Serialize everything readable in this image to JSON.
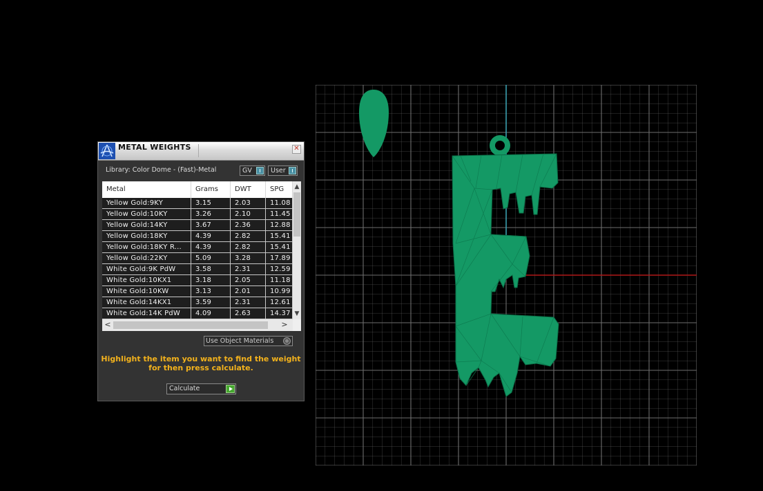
{
  "panel": {
    "title": "METAL WEIGHTS",
    "close_glyph": "✕",
    "library": "Library: Color Dome - (Fast)-Metal",
    "gv_label": "GV",
    "user_label": "User",
    "columns": [
      "Metal",
      "Grams",
      "DWT",
      "SPG"
    ],
    "rows": [
      {
        "metal": "Yellow Gold:9KY",
        "grams": "3.15",
        "dwt": "2.03",
        "spg": "11.08"
      },
      {
        "metal": "Yellow Gold:10KY",
        "grams": "3.26",
        "dwt": "2.10",
        "spg": "11.45"
      },
      {
        "metal": "Yellow Gold:14KY",
        "grams": "3.67",
        "dwt": "2.36",
        "spg": "12.88"
      },
      {
        "metal": "Yellow Gold:18KY",
        "grams": "4.39",
        "dwt": "2.82",
        "spg": "15.41"
      },
      {
        "metal": "Yellow Gold:18KY R...",
        "grams": "4.39",
        "dwt": "2.82",
        "spg": "15.41"
      },
      {
        "metal": "Yellow Gold:22KY",
        "grams": "5.09",
        "dwt": "3.28",
        "spg": "17.89"
      },
      {
        "metal": "White Gold:9K PdW",
        "grams": "3.58",
        "dwt": "2.31",
        "spg": "12.59"
      },
      {
        "metal": "White Gold:10KX1",
        "grams": "3.18",
        "dwt": "2.05",
        "spg": "11.18"
      },
      {
        "metal": "White Gold:10KW",
        "grams": "3.13",
        "dwt": "2.01",
        "spg": "10.99"
      },
      {
        "metal": "White Gold:14KX1",
        "grams": "3.59",
        "dwt": "2.31",
        "spg": "12.61"
      },
      {
        "metal": "White Gold:14K PdW",
        "grams": "4.09",
        "dwt": "2.63",
        "spg": "14.37"
      }
    ],
    "scroll_up": "▲",
    "scroll_down": "▼",
    "scroll_left": "<",
    "scroll_right": ">",
    "use_object_materials": "Use Object Materials",
    "hint": "Highlight the item you want to find the weight for then press calculate.",
    "calculate_label": "Calculate"
  },
  "viewport": {
    "model_color": "#149965",
    "grid_color": "#6e6e6e",
    "axis_x_color": "#b01818",
    "axis_y_color": "#3aa6b8"
  }
}
